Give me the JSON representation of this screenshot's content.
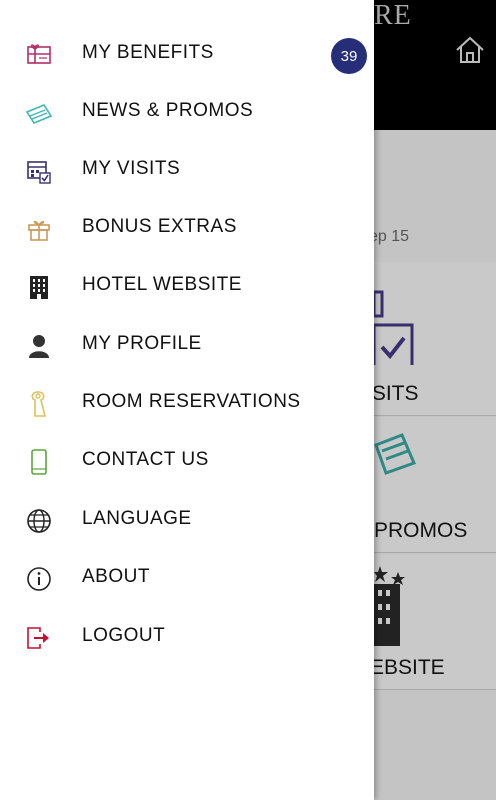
{
  "background": {
    "brand_fragment": "RE",
    "date_fragment": "ep 15",
    "cards": [
      {
        "label": "ISITS"
      },
      {
        "label": "PROMOS"
      },
      {
        "label": "EBSITE"
      }
    ]
  },
  "drawer": {
    "items": [
      {
        "label": "MY BENEFITS",
        "icon": "gift-card-icon",
        "badge": "39"
      },
      {
        "label": "NEWS & PROMOS",
        "icon": "tickets-icon"
      },
      {
        "label": "MY VISITS",
        "icon": "calendar-check-icon"
      },
      {
        "label": "BONUS EXTRAS",
        "icon": "gift-box-icon"
      },
      {
        "label": "HOTEL WEBSITE",
        "icon": "hotel-building-icon"
      },
      {
        "label": "MY PROFILE",
        "icon": "person-icon"
      },
      {
        "label": "ROOM RESERVATIONS",
        "icon": "door-hanger-icon"
      },
      {
        "label": "CONTACT US",
        "icon": "phone-icon"
      },
      {
        "label": "LANGUAGE",
        "icon": "globe-icon"
      },
      {
        "label": "ABOUT",
        "icon": "info-icon"
      },
      {
        "label": "LOGOUT",
        "icon": "logout-icon"
      }
    ]
  },
  "colors": {
    "badge": "#262e7a",
    "benefits_icon": "#b0306a",
    "promos_icon": "#3fb8b0",
    "visits_icon": "#3a2f6e",
    "bonus_icon": "#c99a5a",
    "phone_icon": "#5aa63a",
    "logout_icon": "#c8102e"
  }
}
